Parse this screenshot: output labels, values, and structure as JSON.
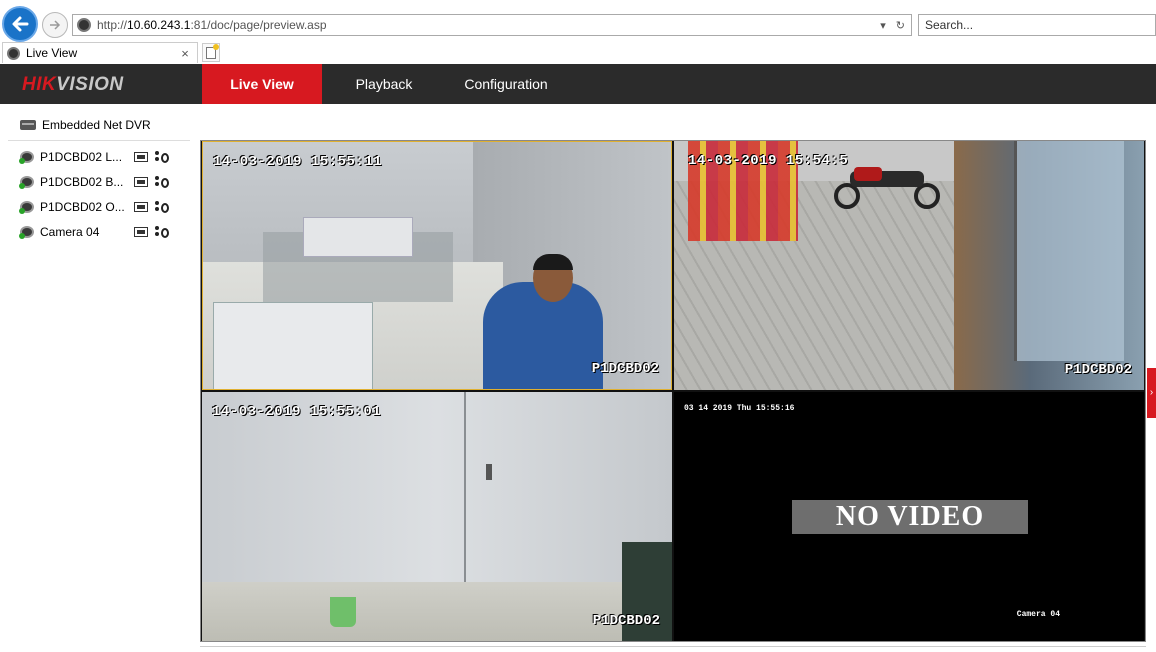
{
  "browser": {
    "url_prefix": "http://",
    "url_host": "10.60.243.1",
    "url_rest": ":81/doc/page/preview.asp",
    "search_placeholder": "Search...",
    "tab_title": "Live View",
    "tab_close": "×"
  },
  "app": {
    "logo_hik": "HIK",
    "logo_vision": "VISION",
    "nav": {
      "live_view": "Live View",
      "playback": "Playback",
      "configuration": "Configuration"
    }
  },
  "sidebar": {
    "device_name": "Embedded Net DVR",
    "cameras": [
      {
        "label": "P1DCBD02 L..."
      },
      {
        "label": "P1DCBD02 B..."
      },
      {
        "label": "P1DCBD02 O..."
      },
      {
        "label": "Camera 04"
      }
    ]
  },
  "video": {
    "tiles": [
      {
        "timestamp": "14-03-2019 15:55:11",
        "channel": "P1DCBD02",
        "selected": true
      },
      {
        "timestamp": "14-03-2019 15:54:5",
        "channel": "P1DCBD02"
      },
      {
        "timestamp": "14-03-2019 15:55:01",
        "channel": "P1DCBD02"
      },
      {
        "timestamp": "03 14 2019 Thu 15:55:16",
        "channel": "Camera 04",
        "status": "NO VIDEO"
      }
    ]
  },
  "colors": {
    "brand_red": "#d71920",
    "topbar": "#2b2b2b",
    "selected_tile_border": "#e0b030"
  }
}
